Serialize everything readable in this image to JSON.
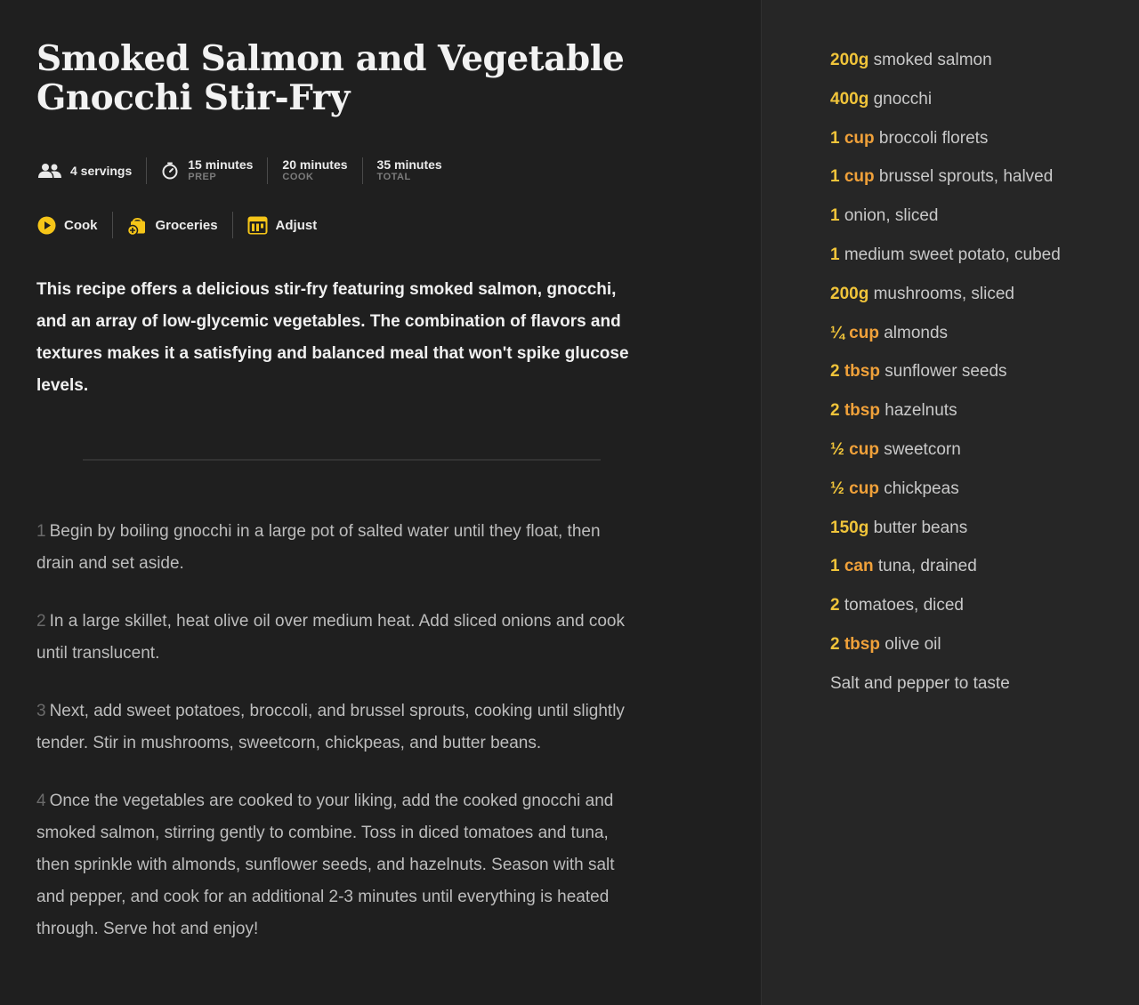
{
  "recipe": {
    "title": "Smoked Salmon and Vegetable Gnocchi Stir-Fry",
    "servings": "4 servings",
    "prep": {
      "value": "15 minutes",
      "label": "PREP"
    },
    "cook": {
      "value": "20 minutes",
      "label": "COOK"
    },
    "total": {
      "value": "35 minutes",
      "label": "TOTAL"
    },
    "description": "This recipe offers a delicious stir-fry featuring smoked salmon, gnocchi, and an array of low-glycemic vegetables. The combination of flavors and textures makes it a satisfying and balanced meal that won't spike glucose levels."
  },
  "actions": {
    "cook": "Cook",
    "groceries": "Groceries",
    "adjust": "Adjust"
  },
  "steps": [
    {
      "num": "1",
      "text": "Begin by boiling gnocchi in a large pot of salted water until they float, then drain and set aside."
    },
    {
      "num": "2",
      "text": "In a large skillet, heat olive oil over medium heat. Add sliced onions and cook until translucent."
    },
    {
      "num": "3",
      "text": "Next, add sweet potatoes, broccoli, and brussel sprouts, cooking until slightly tender. Stir in mushrooms, sweetcorn, chickpeas, and butter beans."
    },
    {
      "num": "4",
      "text": "Once the vegetables are cooked to your liking, add the cooked gnocchi and smoked salmon, stirring gently to combine. Toss in diced tomatoes and tuna, then sprinkle with almonds, sunflower seeds, and hazelnuts. Season with salt and pepper, and cook for an additional 2-3 minutes until everything is heated through. Serve hot and enjoy!"
    }
  ],
  "ingredients": [
    {
      "qty": "200g",
      "unit": "",
      "name": "smoked salmon"
    },
    {
      "qty": "400g",
      "unit": "",
      "name": "gnocchi"
    },
    {
      "qty": "1",
      "unit": "cup",
      "name": "broccoli florets"
    },
    {
      "qty": "1",
      "unit": "cup",
      "name": "brussel sprouts, halved"
    },
    {
      "qty": "1",
      "unit": "",
      "name": "onion, sliced"
    },
    {
      "qty": "1",
      "unit": "",
      "name": "medium sweet potato, cubed"
    },
    {
      "qty": "200g",
      "unit": "",
      "name": "mushrooms, sliced"
    },
    {
      "qty": "¼",
      "unit": "cup",
      "name": "almonds"
    },
    {
      "qty": "2",
      "unit": "tbsp",
      "name": "sunflower seeds"
    },
    {
      "qty": "2",
      "unit": "tbsp",
      "name": "hazelnuts"
    },
    {
      "qty": "½",
      "unit": "cup",
      "name": "sweetcorn"
    },
    {
      "qty": "½",
      "unit": "cup",
      "name": "chickpeas"
    },
    {
      "qty": "150g",
      "unit": "",
      "name": "butter beans"
    },
    {
      "qty": "1",
      "unit": "can",
      "name": "tuna, drained"
    },
    {
      "qty": "2",
      "unit": "",
      "name": "tomatoes, diced"
    },
    {
      "qty": "2",
      "unit": "tbsp",
      "name": "olive oil"
    },
    {
      "qty": "",
      "unit": "",
      "name": "Salt and pepper to taste"
    }
  ],
  "icons": {
    "servings": "people-icon",
    "prep": "timer-icon",
    "cook": "play-circle-icon",
    "groceries": "grocery-bag-icon",
    "adjust": "scale-adjust-icon"
  },
  "colors": {
    "accent_quantity": "#f0c43a",
    "accent_unit": "#f0a13a",
    "background_main": "#1f1f1f",
    "background_sidebar": "#262626"
  }
}
